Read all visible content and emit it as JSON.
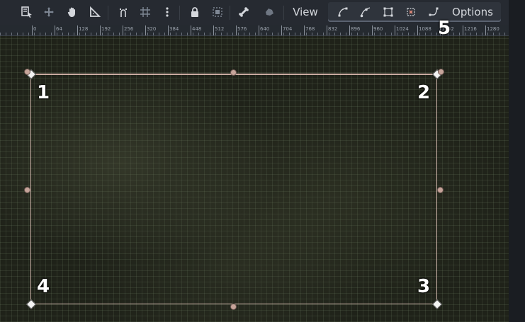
{
  "toolbar": {
    "view_label": "View",
    "options_label": "Options"
  },
  "ruler": {
    "labels": [
      "0",
      "64",
      "128",
      "192",
      "256",
      "320",
      "384",
      "448",
      "512",
      "576",
      "640",
      "704",
      "768",
      "832",
      "896",
      "960",
      "1024",
      "1088",
      "1152",
      "1216",
      "1280"
    ]
  },
  "annotations": {
    "n1": "1",
    "n2": "2",
    "n3": "3",
    "n4": "4",
    "n5": "5"
  },
  "colors": {
    "toolbar_bg": "#262a31",
    "icon": "#d4d7dc",
    "icon_dim": "#7e8794",
    "selection_outline": "#e6c8be",
    "handle": "#f4f4f4"
  }
}
